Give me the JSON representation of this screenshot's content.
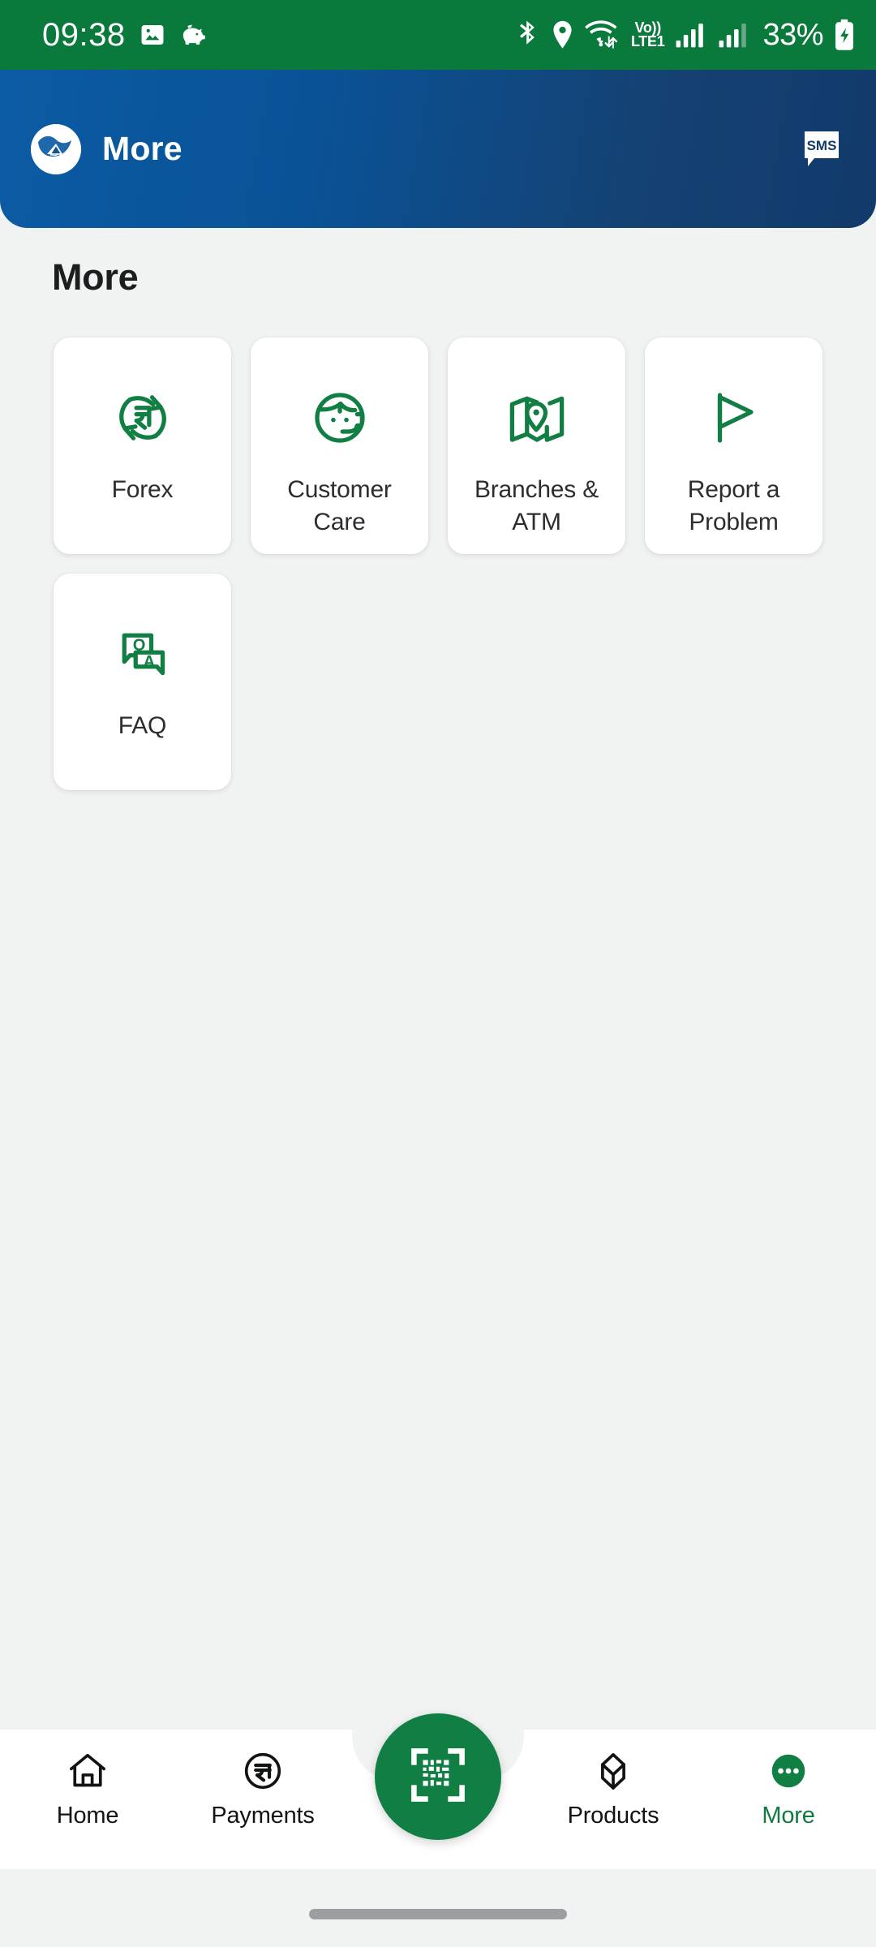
{
  "status_bar": {
    "time": "09:38",
    "left_icons": [
      "image-icon",
      "piggy-bank-icon"
    ],
    "right_icons": [
      "bluetooth-icon",
      "location-icon",
      "wifi-icon",
      "signal-icon",
      "signal-icon"
    ],
    "network_label_top": "Vo))",
    "network_label_bottom": "LTE1",
    "battery_percent": "33%",
    "battery_state": "charging",
    "background_color": "#0a7a3c"
  },
  "header": {
    "logo_icon": "bank-logo-icon",
    "title": "More",
    "action_icon": "sms-icon",
    "action_label": "SMS",
    "gradient_start": "#0b5ba4",
    "gradient_end": "#123a6b"
  },
  "main": {
    "page_title": "More",
    "accent_color": "#117f43",
    "items": [
      {
        "label": "Forex",
        "icon": "currency-exchange-icon"
      },
      {
        "label": "Customer Care",
        "icon": "headset-support-icon"
      },
      {
        "label": "Branches & ATM",
        "icon": "map-pin-icon"
      },
      {
        "label": "Report a Problem",
        "icon": "flag-icon"
      },
      {
        "label": "FAQ",
        "icon": "question-answer-icon"
      }
    ]
  },
  "bottom_nav": {
    "fab_icon": "qr-scan-icon",
    "fab_color": "#117f43",
    "active_color": "#107a3f",
    "items": [
      {
        "label": "Home",
        "icon": "home-icon",
        "active": false
      },
      {
        "label": "Payments",
        "icon": "rupee-circle-icon",
        "active": false
      },
      {
        "label": "Products",
        "icon": "box-3d-icon",
        "active": false
      },
      {
        "label": "More",
        "icon": "more-dots-icon",
        "active": true
      }
    ]
  }
}
